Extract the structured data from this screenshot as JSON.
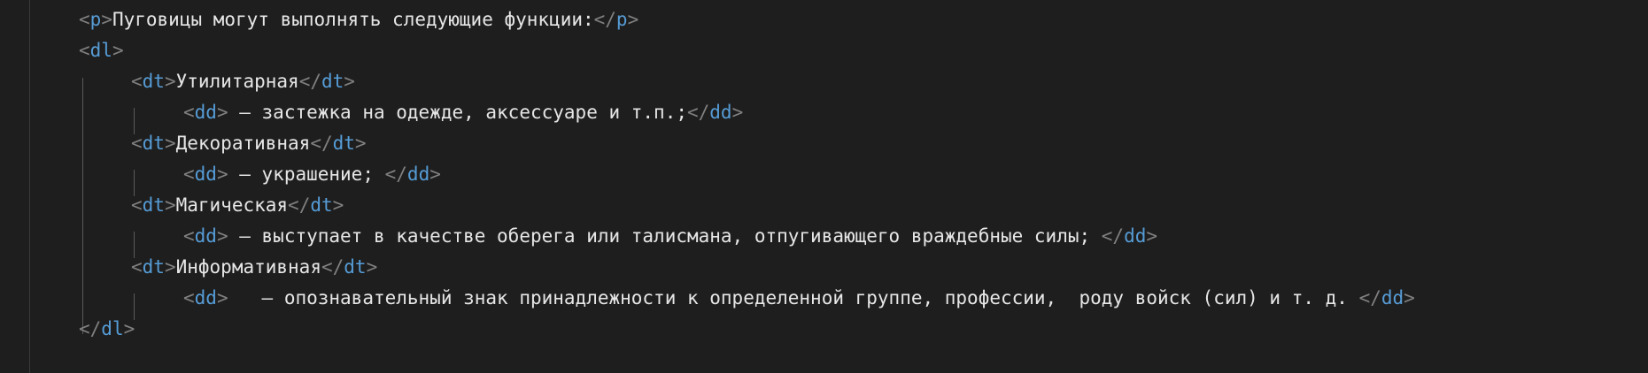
{
  "editor": {
    "lines": [
      {
        "indent": 0,
        "open_tag": "p",
        "text": "Пуговицы могут выполнять следующие функции:",
        "close_tag": "p"
      },
      {
        "indent": 0,
        "open_tag": "dl",
        "text": "",
        "close_tag": ""
      },
      {
        "indent": 1,
        "open_tag": "dt",
        "text": "Утилитарная",
        "close_tag": "dt"
      },
      {
        "indent": 2,
        "open_tag": "dd",
        "text": " — застежка на одежде, аксессуаре и т.п.;",
        "close_tag": "dd"
      },
      {
        "indent": 1,
        "open_tag": "dt",
        "text": "Декоративная",
        "close_tag": "dt"
      },
      {
        "indent": 2,
        "open_tag": "dd",
        "text": " – украшение; ",
        "close_tag": "dd"
      },
      {
        "indent": 1,
        "open_tag": "dt",
        "text": "Магическая",
        "close_tag": "dt"
      },
      {
        "indent": 2,
        "open_tag": "dd",
        "text": " – выступает в качестве оберега или талисмана, отпугивающего враждебные силы; ",
        "close_tag": "dd"
      },
      {
        "indent": 1,
        "open_tag": "dt",
        "text": "Информативная",
        "close_tag": "dt"
      },
      {
        "indent": 2,
        "open_tag": "dd",
        "text": "   – опознавательный знак принадлежности к определенной группе, профессии,  роду войск (сил) и т. д. ",
        "close_tag": "dd"
      },
      {
        "indent": 0,
        "open_tag": "",
        "text": "",
        "close_tag": "dl"
      }
    ]
  },
  "colors": {
    "background": "#1e1e1e",
    "tag_name": "#569cd6",
    "tag_bracket": "#808080",
    "text": "#e6e6e6"
  }
}
